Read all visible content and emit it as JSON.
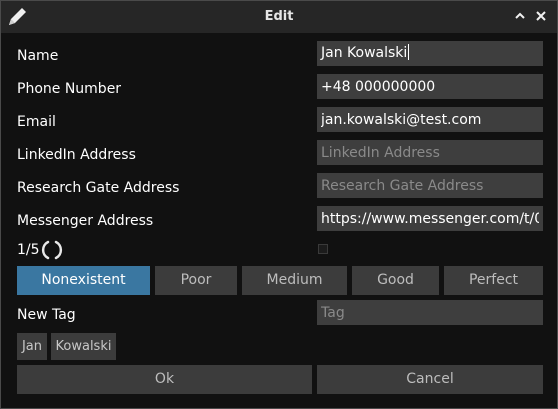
{
  "window": {
    "title": "Edit"
  },
  "form": {
    "name": {
      "label": "Name",
      "value": "Jan Kowalski",
      "placeholder": ""
    },
    "phone": {
      "label": "Phone Number",
      "value": "+48 000000000",
      "placeholder": ""
    },
    "email": {
      "label": "Email",
      "value": "jan.kowalski@test.com",
      "placeholder": ""
    },
    "linkedin": {
      "label": "LinkedIn Address",
      "value": "",
      "placeholder": "LinkedIn Address"
    },
    "researchgate": {
      "label": "Research Gate Address",
      "value": "",
      "placeholder": "Research Gate Address"
    },
    "messenger": {
      "label": "Messenger Address",
      "value": "https://www.messenger.com/t/0",
      "placeholder": ""
    }
  },
  "rating": {
    "text": "1/5",
    "checkbox_checked": false,
    "levels": [
      "Nonexistent",
      "Poor",
      "Medium",
      "Good",
      "Perfect"
    ],
    "selected": "Nonexistent"
  },
  "tags": {
    "label": "New Tag",
    "placeholder": "Tag",
    "items": [
      "Jan",
      "Kowalski"
    ]
  },
  "buttons": {
    "ok": "Ok",
    "cancel": "Cancel"
  },
  "colors": {
    "accent": "#3a77a1",
    "field_bg": "#3e3e3e",
    "window_bg": "#111111"
  },
  "icons": {
    "app": "pencil-icon",
    "minimize": "chevron-up-icon",
    "close": "close-icon",
    "spinner": "loading-spinner-icon"
  }
}
